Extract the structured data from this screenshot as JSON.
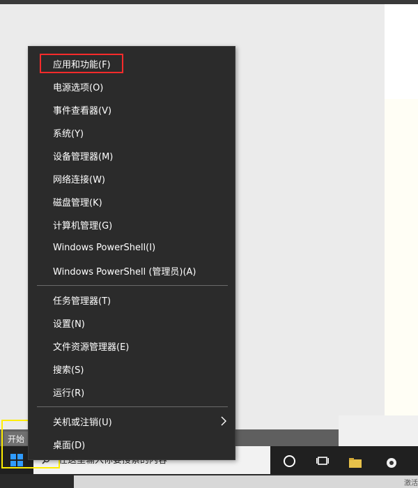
{
  "colors": {
    "menu_bg": "#2b2b2b",
    "menu_text": "#ffffff",
    "taskbar_bg": "#202020",
    "windows_blue": "#2f9bff",
    "red_annotation": "#ff2b2b",
    "yellow_annotation": "#ffee00"
  },
  "menu": {
    "group1": [
      {
        "label": "应用和功能(F)"
      },
      {
        "label": "电源选项(O)"
      },
      {
        "label": "事件查看器(V)"
      },
      {
        "label": "系统(Y)"
      },
      {
        "label": "设备管理器(M)"
      },
      {
        "label": "网络连接(W)"
      },
      {
        "label": "磁盘管理(K)"
      },
      {
        "label": "计算机管理(G)"
      },
      {
        "label": "Windows PowerShell(I)"
      },
      {
        "label": "Windows PowerShell (管理员)(A)"
      }
    ],
    "group2": [
      {
        "label": "任务管理器(T)"
      },
      {
        "label": "设置(N)"
      },
      {
        "label": "文件资源管理器(E)"
      },
      {
        "label": "搜索(S)"
      },
      {
        "label": "运行(R)"
      }
    ],
    "group3": [
      {
        "label": "关机或注销(U)",
        "has_submenu": true
      },
      {
        "label": "桌面(D)"
      }
    ]
  },
  "start_tooltip": "开始",
  "taskbar": {
    "search_placeholder": "在这里输入你要搜索的内容",
    "start_icon": "windows-logo-icon",
    "cortana_icon": "cortana-circle-icon",
    "task_view_icon": "task-view-icon"
  },
  "corner_text": "激活"
}
